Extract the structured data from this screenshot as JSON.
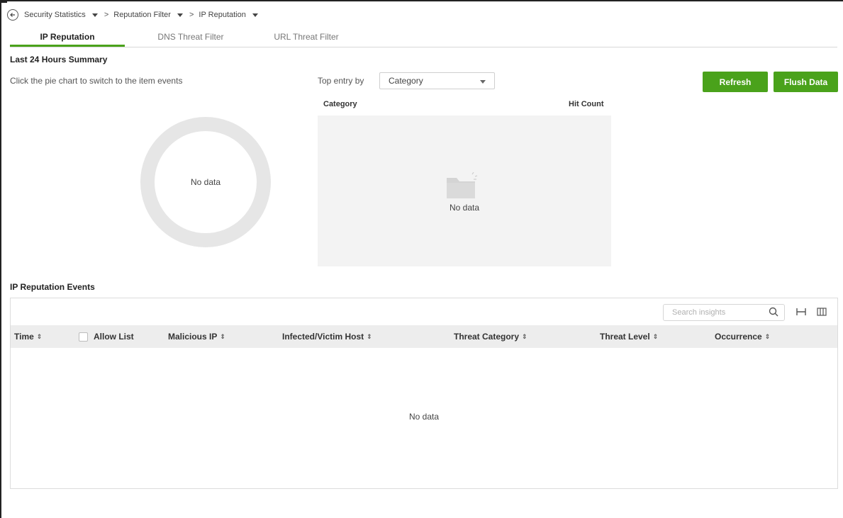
{
  "breadcrumb": {
    "items": [
      {
        "label": "Security Statistics"
      },
      {
        "label": "Reputation Filter"
      },
      {
        "label": "IP Reputation"
      }
    ],
    "separator": ">"
  },
  "tabs": [
    {
      "label": "IP Reputation",
      "active": true
    },
    {
      "label": "DNS Threat Filter",
      "active": false
    },
    {
      "label": "URL Threat Filter",
      "active": false
    }
  ],
  "summary": {
    "title": "Last 24 Hours Summary",
    "hint": "Click the pie chart to switch to the item events",
    "top_entry_label": "Top entry by",
    "top_entry_value": "Category",
    "refresh_label": "Refresh",
    "flush_label": "Flush Data",
    "pie_empty": "No data",
    "category_header": "Category",
    "hit_count_header": "Hit Count",
    "category_empty": "No data"
  },
  "events": {
    "title": "IP Reputation Events",
    "search_placeholder": "Search insights",
    "columns": [
      {
        "label": "Time",
        "sortable": true
      },
      {
        "label": "Allow List",
        "sortable": false,
        "checkbox": true
      },
      {
        "label": "Malicious IP",
        "sortable": true
      },
      {
        "label": "Infected/Victim Host",
        "sortable": true
      },
      {
        "label": "Threat Category",
        "sortable": true
      },
      {
        "label": "Threat Level",
        "sortable": true
      },
      {
        "label": "Occurrence",
        "sortable": true
      }
    ],
    "empty": "No data"
  },
  "colors": {
    "accent": "#4aa21b",
    "panel_bg": "#f3f3f3",
    "table_header_bg": "#ededed",
    "donut": "#e6e6e6"
  }
}
